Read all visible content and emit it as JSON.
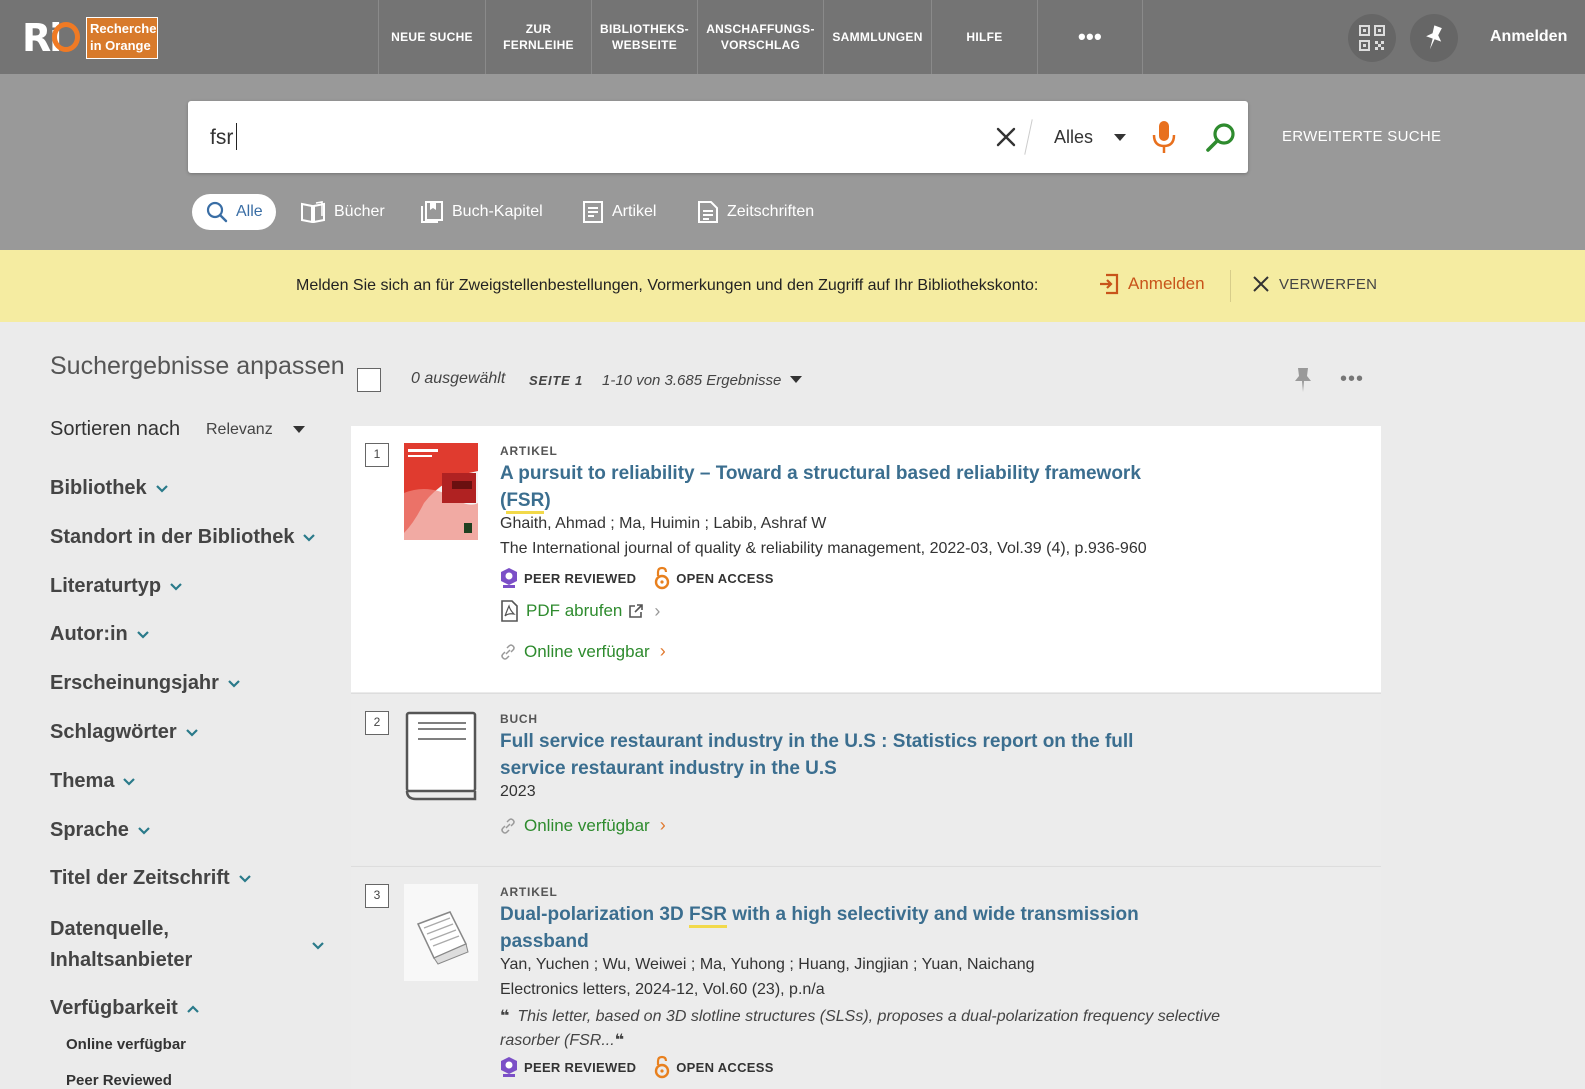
{
  "header": {
    "logo_text": "Ri",
    "logo_sub1": "Recherche",
    "logo_sub2": "in Orange",
    "nav": [
      {
        "label": "NEUE SUCHE"
      },
      {
        "label": "ZUR FERNLEIHE"
      },
      {
        "label": "BIBLIOTHEKS-WEBSEITE"
      },
      {
        "label": "ANSCHAFFUNGS-VORSCHLAG"
      },
      {
        "label": "SAMMLUNGEN"
      },
      {
        "label": "HILFE"
      }
    ],
    "more_label": "•••",
    "signin_label": "Anmelden"
  },
  "search": {
    "query": "fsr",
    "scope": "Alles",
    "advanced_label": "ERWEITERTE SUCHE",
    "types": [
      {
        "label": "Alle",
        "icon": "search-icon"
      },
      {
        "label": "Bücher",
        "icon": "book-icon"
      },
      {
        "label": "Buch-Kapitel",
        "icon": "chapter-icon"
      },
      {
        "label": "Artikel",
        "icon": "article-icon"
      },
      {
        "label": "Zeitschriften",
        "icon": "journal-icon"
      }
    ]
  },
  "banner": {
    "text": "Melden Sie sich an für Zweigstellenbestellungen, Vormerkungen und den Zugriff auf Ihr Bibliothekskonto:",
    "login_label": "Anmelden",
    "dismiss_label": "VERWERFEN"
  },
  "sidebar": {
    "title": "Suchergebnisse anpassen",
    "sort_label": "Sortieren nach",
    "sort_value": "Relevanz",
    "facets": [
      {
        "label": "Bibliothek"
      },
      {
        "label": "Standort in der Bibliothek"
      },
      {
        "label": "Literaturtyp"
      },
      {
        "label": "Autor:in"
      },
      {
        "label": "Erscheinungsjahr"
      },
      {
        "label": "Schlagwörter"
      },
      {
        "label": "Thema"
      },
      {
        "label": "Sprache"
      },
      {
        "label": "Titel der Zeitschrift"
      }
    ],
    "facet_datenquelle_1": "Datenquelle,",
    "facet_datenquelle_2": "Inhaltsanbieter",
    "facet_availability": "Verfügbarkeit",
    "availability_options": [
      "Online verfügbar",
      "Peer Reviewed"
    ]
  },
  "results": {
    "selected": "0 ausgewählt",
    "page": "SEITE 1",
    "range": "1-10 von 3.685 Ergebnisse",
    "items": [
      {
        "number": "1",
        "type": "ARTIKEL",
        "title_pre": "A pursuit to reliability – Toward a structural based reliability framework (",
        "title_hl": "FSR",
        "title_post": ")",
        "authors": "Ghaith, Ahmad ; Ma, Huimin ; Labib, Ashraf W",
        "source": "The International journal of quality & reliability management, 2022-03, Vol.39 (4), p.936-960",
        "badge_peer": "PEER REVIEWED",
        "badge_oa": "OPEN ACCESS",
        "pdf_label": "PDF abrufen",
        "online_label": "Online verfügbar"
      },
      {
        "number": "2",
        "type": "BUCH",
        "title": "Full service restaurant industry in the U.S : Statistics report on the full service restaurant industry in the U.S",
        "year": "2023",
        "online_label": "Online verfügbar"
      },
      {
        "number": "3",
        "type": "ARTIKEL",
        "title_pre": "Dual-polarization 3D ",
        "title_hl": "FSR",
        "title_post": " with a high selectivity and wide transmission passband",
        "authors": "Yan, Yuchen ; Wu, Weiwei ; Ma, Yuhong ; Huang, Jingjian ; Yuan, Naichang",
        "source": "Electronics letters, 2024-12, Vol.60 (23), p.n/a",
        "abstract": "This letter, based on 3D slotline structures (SLSs), proposes a dual-polarization frequency selective rasorber (FSR...",
        "badge_peer": "PEER REVIEWED",
        "badge_oa": "OPEN ACCESS"
      }
    ]
  },
  "colors": {
    "nav_bg": "#747474",
    "search_band": "#999999",
    "banner_bg": "#f5eca1",
    "link_green": "#2e8b2e",
    "title_blue": "#3b6e8f",
    "accent_orange": "#c8541a"
  }
}
